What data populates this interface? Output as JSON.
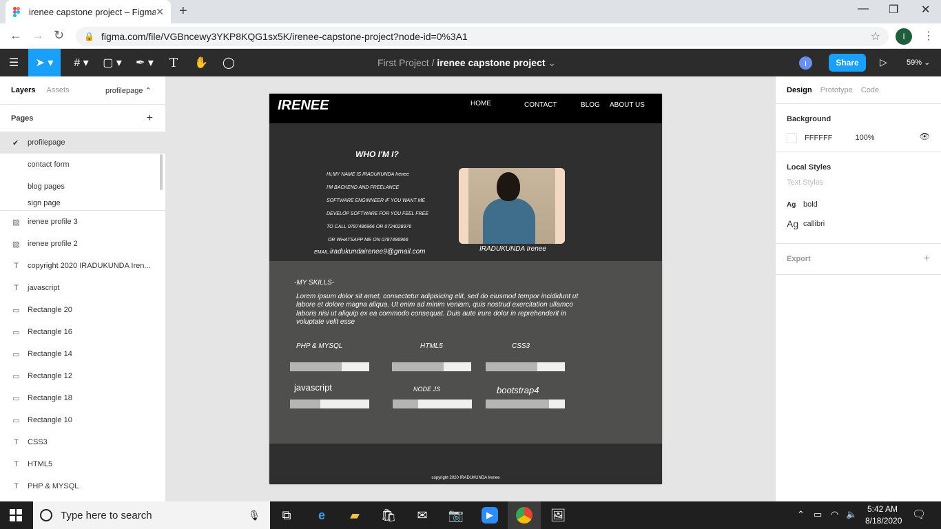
{
  "browser": {
    "tab_title": "irenee capstone project – Figma",
    "url": "figma.com/file/VGBncewy3YKP8KQG1sx5K/irenee-capstone-project?node-id=0%3A1",
    "profile_initial": "I"
  },
  "figma_toolbar": {
    "project": "First Project",
    "separator": "/",
    "file_name": "irenee capstone project",
    "avatar_initial": "I",
    "share_label": "Share",
    "zoom": "59%"
  },
  "left_panel": {
    "tabs": [
      "Layers",
      "Assets"
    ],
    "current_page_selector": "profilepage",
    "pages_header": "Pages",
    "pages": [
      "profilepage",
      "contact form",
      "blog pages",
      "sign page"
    ],
    "layers": [
      {
        "name": "irenee profile 3",
        "icon": "image-icon"
      },
      {
        "name": "irenee profile 2",
        "icon": "image-icon"
      },
      {
        "name": "copyright 2020 IRADUKUNDA Iren...",
        "icon": "text-icon"
      },
      {
        "name": "javascript",
        "icon": "text-icon"
      },
      {
        "name": "Rectangle 20",
        "icon": "rectangle-icon"
      },
      {
        "name": "Rectangle 16",
        "icon": "rectangle-icon"
      },
      {
        "name": "Rectangle 14",
        "icon": "rectangle-icon"
      },
      {
        "name": "Rectangle 12",
        "icon": "rectangle-icon"
      },
      {
        "name": "Rectangle 18",
        "icon": "rectangle-icon"
      },
      {
        "name": "Rectangle 10",
        "icon": "rectangle-icon"
      },
      {
        "name": "CSS3",
        "icon": "text-icon"
      },
      {
        "name": "HTML5",
        "icon": "text-icon"
      },
      {
        "name": "PHP & MYSQL",
        "icon": "text-icon"
      }
    ]
  },
  "design": {
    "logo": "IRENEE",
    "nav": [
      "HOME",
      "CONTACT",
      "BLOG",
      "ABOUT US"
    ],
    "hero_title": "WHO I'M I?",
    "intro_lines": [
      "HI,MY NAME  IS IRADUKUNDA Irenee",
      "I'M BACKEND AND FREELANCE",
      "SOFTWARE ENGINNEER IF YOU WANT ME",
      "DEVELOP SOFTWARE  FOR YOU FEEL FREE",
      "TO CALL 0787486966 OR 0724028976",
      " OR WHATSAPP ME ON 0787486966"
    ],
    "email_label": "EMAIL:",
    "email": "iradukundairenee9@gmail.com",
    "photo_caption": "IRADUKUNDA Irenee",
    "skills_title": "-MY SKILLS-",
    "lorem": "Lorem ipsum dolor sit amet, consectetur adipisicing elit, sed do eiusmod tempor incididunt ut labore et dolore magna aliqua. Ut enim ad minim veniam, quis nostrud exercitation ullamco laboris nisi ut aliquip ex ea commodo consequat. Duis aute irure dolor in reprehenderit in voluptate velit esse",
    "skills": [
      {
        "label": "PHP & MYSQL",
        "level": 0.65
      },
      {
        "label": "HTML5",
        "level": 0.65
      },
      {
        "label": "CSS3",
        "level": 0.65
      },
      {
        "label": "javascript",
        "level": 0.38
      },
      {
        "label": "NODE JS",
        "level": 0.32
      },
      {
        "label": "bootstrap4",
        "level": 0.8
      }
    ],
    "copyright": "copyright 2020 IRADUKUNDA Irenee"
  },
  "right_panel": {
    "tabs": [
      "Design",
      "Prototype",
      "Code"
    ],
    "background_header": "Background",
    "bg_hex": "FFFFFF",
    "bg_opacity": "100%",
    "local_styles_header": "Local Styles",
    "text_styles_label": "Text Styles",
    "styles": [
      {
        "ag": "Ag",
        "name": "bold"
      },
      {
        "ag": "Ag",
        "name": "callibri"
      }
    ],
    "export_header": "Export"
  },
  "taskbar": {
    "search_placeholder": "Type here to search",
    "time": "5:42 AM",
    "date": "8/18/2020"
  },
  "colors": {
    "figma_blue": "#18a0fb",
    "toolbar_dark": "#2c2c2c",
    "design_dark": "#2f2f2f",
    "design_gray": "#4f4f4d"
  }
}
